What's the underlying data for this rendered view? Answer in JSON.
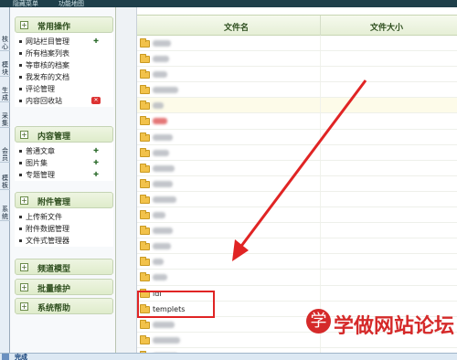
{
  "topbar": {
    "links": [
      "隐藏菜单",
      "功能地图"
    ]
  },
  "vtabs": [
    "核心",
    "模块",
    "生成",
    "采集",
    "会员",
    "模板",
    "系统"
  ],
  "sidebar": {
    "panels": [
      {
        "title": "常用操作",
        "toggle": "+",
        "items": [
          {
            "label": "网站栏目管理",
            "icon": "add-icon"
          },
          {
            "label": "所有档案列表",
            "icon": ""
          },
          {
            "label": "等审核的档案",
            "icon": ""
          },
          {
            "label": "我发布的文档",
            "icon": ""
          },
          {
            "label": "评论管理",
            "icon": ""
          },
          {
            "label": "内容回收站",
            "icon": "delete-icon"
          }
        ]
      },
      {
        "title": "内容管理",
        "toggle": "+",
        "items": [
          {
            "label": "普通文章",
            "icon": "add-icon"
          },
          {
            "label": "图片集",
            "icon": "add-icon"
          },
          {
            "label": "专题管理",
            "icon": "add-icon"
          }
        ]
      },
      {
        "title": "附件管理",
        "toggle": "+",
        "items": [
          {
            "label": "上传新文件",
            "icon": ""
          },
          {
            "label": "附件数据管理",
            "icon": ""
          },
          {
            "label": "文件式管理器",
            "icon": ""
          }
        ]
      },
      {
        "title": "频道模型",
        "toggle": "+",
        "items": []
      },
      {
        "title": "批量维护",
        "toggle": "+",
        "items": []
      },
      {
        "title": "系统帮助",
        "toggle": "+",
        "items": []
      }
    ]
  },
  "table": {
    "col_name": "文件名",
    "col_size": "文件大小",
    "rows": [
      {
        "name": "",
        "blur": "gray"
      },
      {
        "name": "",
        "blur": "gray"
      },
      {
        "name": "",
        "blur": "gray"
      },
      {
        "name": "",
        "blur": "gray"
      },
      {
        "name": "",
        "blur": "gray"
      },
      {
        "name": "",
        "blur": "red"
      },
      {
        "name": "",
        "blur": "gray"
      },
      {
        "name": "",
        "blur": "gray"
      },
      {
        "name": "",
        "blur": "gray"
      },
      {
        "name": "",
        "blur": "gray"
      },
      {
        "name": "",
        "blur": "gray"
      },
      {
        "name": "",
        "blur": "gray"
      },
      {
        "name": "",
        "blur": "gray"
      },
      {
        "name": "",
        "blur": "gray"
      },
      {
        "name": "",
        "blur": "gray"
      },
      {
        "name": "",
        "blur": "gray"
      },
      {
        "name": "idl",
        "blur": "none"
      },
      {
        "name": "templets",
        "blur": "none"
      },
      {
        "name": "",
        "blur": "gray"
      },
      {
        "name": "",
        "blur": "gray"
      },
      {
        "name": "",
        "blur": "gray"
      }
    ]
  },
  "watermark": {
    "badge": "学",
    "text": "学做网站论坛"
  },
  "status": {
    "text": "完成"
  },
  "colors": {
    "annotation": "#e02424",
    "panel_head": "#dfeccb",
    "folder": "#f2c24a"
  }
}
